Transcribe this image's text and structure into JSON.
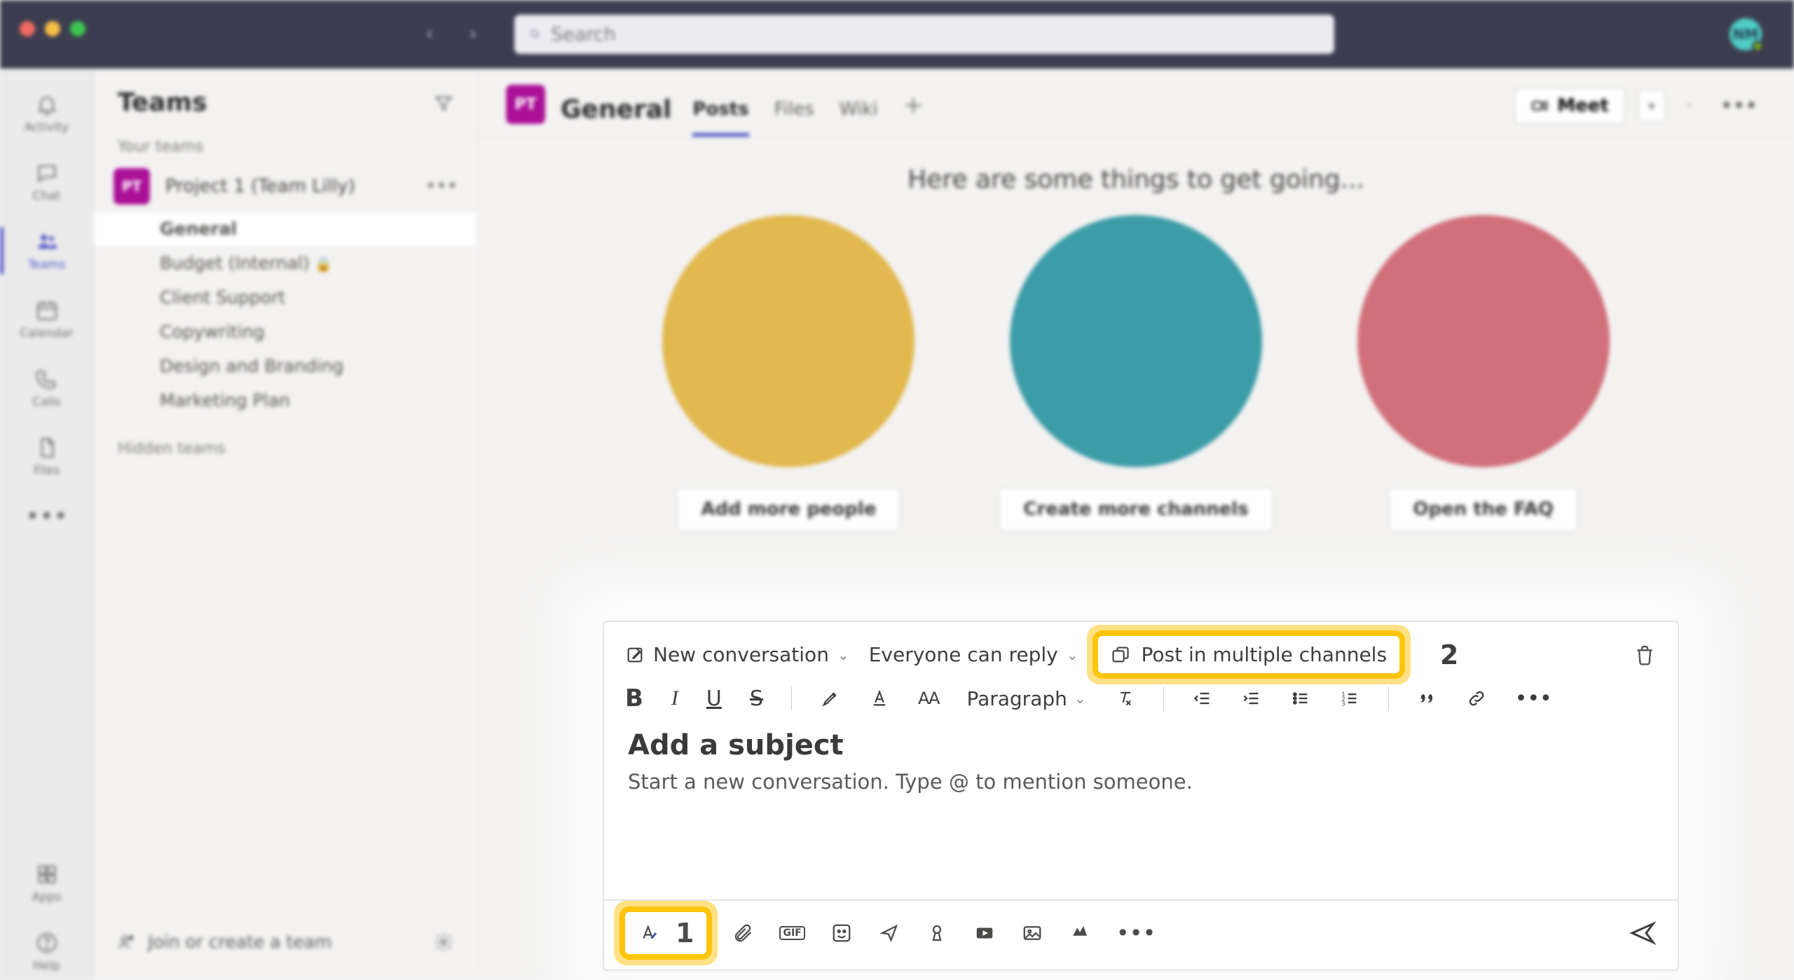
{
  "titlebar": {
    "search_placeholder": "Search",
    "avatar_initials": "NM"
  },
  "rail": {
    "items": [
      {
        "label": "Activity",
        "icon": "bell"
      },
      {
        "label": "Chat",
        "icon": "chat"
      },
      {
        "label": "Teams",
        "icon": "people",
        "active": true
      },
      {
        "label": "Calendar",
        "icon": "calendar"
      },
      {
        "label": "Calls",
        "icon": "phone"
      },
      {
        "label": "Files",
        "icon": "file"
      }
    ],
    "more_label": "",
    "apps_label": "Apps",
    "help_label": "Help"
  },
  "sidebar": {
    "title": "Teams",
    "your_teams_label": "Your teams",
    "team": {
      "initials": "PT",
      "name": "Project 1 (Team Lilly)"
    },
    "channels": [
      {
        "label": "General",
        "active": true
      },
      {
        "label": "Budget (Internal)",
        "private": true
      },
      {
        "label": "Client Support"
      },
      {
        "label": "Copywriting"
      },
      {
        "label": "Design and Branding"
      },
      {
        "label": "Marketing Plan"
      }
    ],
    "hidden_label": "Hidden teams",
    "join_label": "Join or create a team"
  },
  "channel_header": {
    "avatar": "PT",
    "name": "General",
    "tabs": [
      {
        "label": "Posts",
        "active": true
      },
      {
        "label": "Files"
      },
      {
        "label": "Wiki"
      }
    ],
    "meet_label": "Meet"
  },
  "hero": {
    "title": "Here are some things to get going...",
    "tiles": [
      {
        "label": "Add more people"
      },
      {
        "label": "Create more channels"
      },
      {
        "label": "Open the FAQ"
      }
    ]
  },
  "composer": {
    "type_label": "New conversation",
    "reply_label": "Everyone can reply",
    "post_multi_label": "Post in multiple channels",
    "callout_2": "2",
    "paragraph_label": "Paragraph",
    "subject_placeholder": "Add a subject",
    "body_placeholder": "Start a new conversation. Type @ to mention someone.",
    "callout_1": "1",
    "font_size_label": "AA",
    "gif_label": "GIF"
  }
}
